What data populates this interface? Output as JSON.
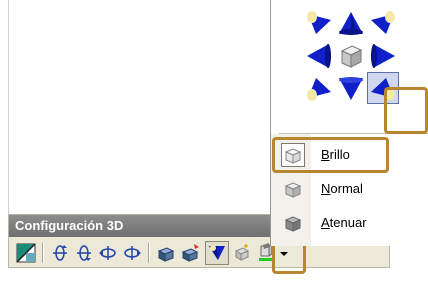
{
  "toolbar": {
    "title": "Configuración 3D",
    "buttons": [
      {
        "id": "toggle-3d",
        "icon": "toggle-3d-icon"
      },
      {
        "id": "tilt-down",
        "icon": "tilt-down-icon"
      },
      {
        "id": "tilt-up",
        "icon": "tilt-up-icon"
      },
      {
        "id": "tilt-left",
        "icon": "tilt-left-icon"
      },
      {
        "id": "tilt-right",
        "icon": "tilt-right-icon"
      },
      {
        "id": "depth",
        "icon": "depth-icon"
      },
      {
        "id": "direction",
        "icon": "direction-icon"
      },
      {
        "id": "lighting",
        "icon": "lighting-icon"
      },
      {
        "id": "surface",
        "icon": "surface-icon"
      },
      {
        "id": "3d-color",
        "icon": "3d-color-icon"
      }
    ],
    "color_swatch": "#22cc22"
  },
  "lighting_menu": {
    "direction_grid": [
      [
        "top-left",
        "top",
        "top-right"
      ],
      [
        "left",
        "front",
        "right"
      ],
      [
        "bottom-left",
        "bottom",
        "bottom-right"
      ]
    ],
    "selected_direction": "bottom-right",
    "intensity_items": [
      {
        "first": "B",
        "rest": "rillo",
        "checked": true
      },
      {
        "first": "N",
        "rest": "ormal",
        "checked": false
      },
      {
        "first": "A",
        "rest": "tenuar",
        "checked": false
      }
    ]
  },
  "colors": {
    "cone_blue": "#1020c8",
    "cone_light": "#f4e9a8",
    "highlight": "#b8862c",
    "toolbar_bg": "#ece9d8",
    "title_bg": "#7c7c7c"
  }
}
